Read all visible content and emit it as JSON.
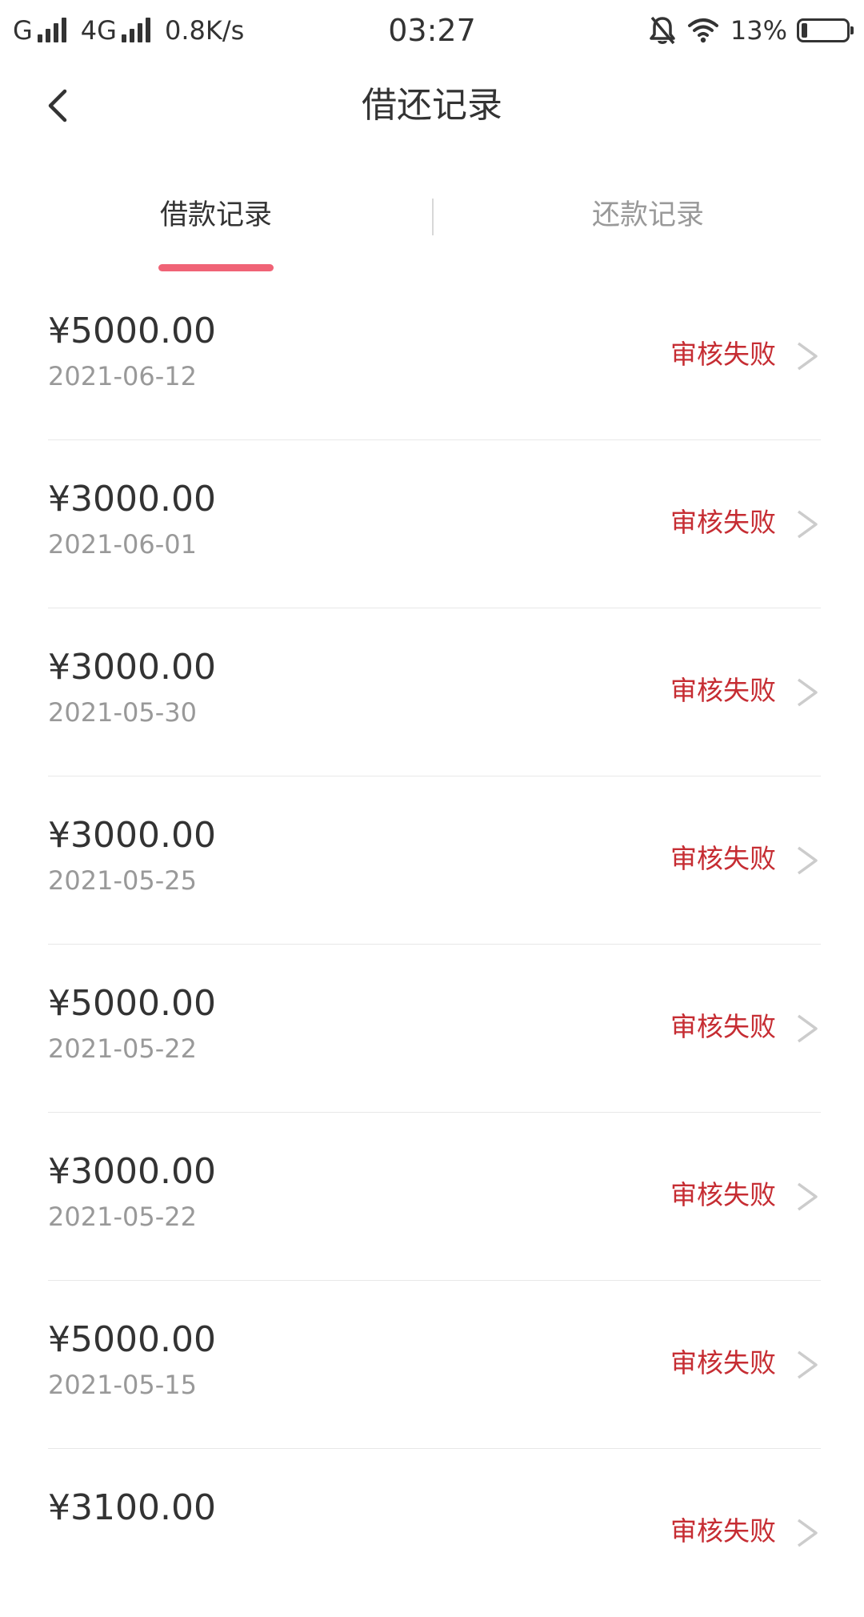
{
  "status_bar": {
    "carrier1": "G",
    "carrier2": "4G",
    "speed": "0.8K/s",
    "time": "03:27",
    "battery": "13%",
    "battery_level": 0.13,
    "icons": [
      "signal-icon",
      "mute-bell-icon",
      "wifi-icon",
      "battery-icon"
    ]
  },
  "nav": {
    "back_icon": "chevron-left-icon",
    "title": "借还记录"
  },
  "tabs": [
    {
      "label": "借款记录",
      "active": true
    },
    {
      "label": "还款记录",
      "active": false
    }
  ],
  "colors": {
    "accent": "#f06376",
    "status_fail": "#c62d33",
    "text_primary": "#333333",
    "text_secondary": "#999999"
  },
  "records": [
    {
      "amount": "¥5000.00",
      "date": "2021-06-12",
      "status": "审核失败"
    },
    {
      "amount": "¥3000.00",
      "date": "2021-06-01",
      "status": "审核失败"
    },
    {
      "amount": "¥3000.00",
      "date": "2021-05-30",
      "status": "审核失败"
    },
    {
      "amount": "¥3000.00",
      "date": "2021-05-25",
      "status": "审核失败"
    },
    {
      "amount": "¥5000.00",
      "date": "2021-05-22",
      "status": "审核失败"
    },
    {
      "amount": "¥3000.00",
      "date": "2021-05-22",
      "status": "审核失败"
    },
    {
      "amount": "¥5000.00",
      "date": "2021-05-15",
      "status": "审核失败"
    },
    {
      "amount": "¥3100.00",
      "date": "",
      "status": "审核失败"
    }
  ]
}
